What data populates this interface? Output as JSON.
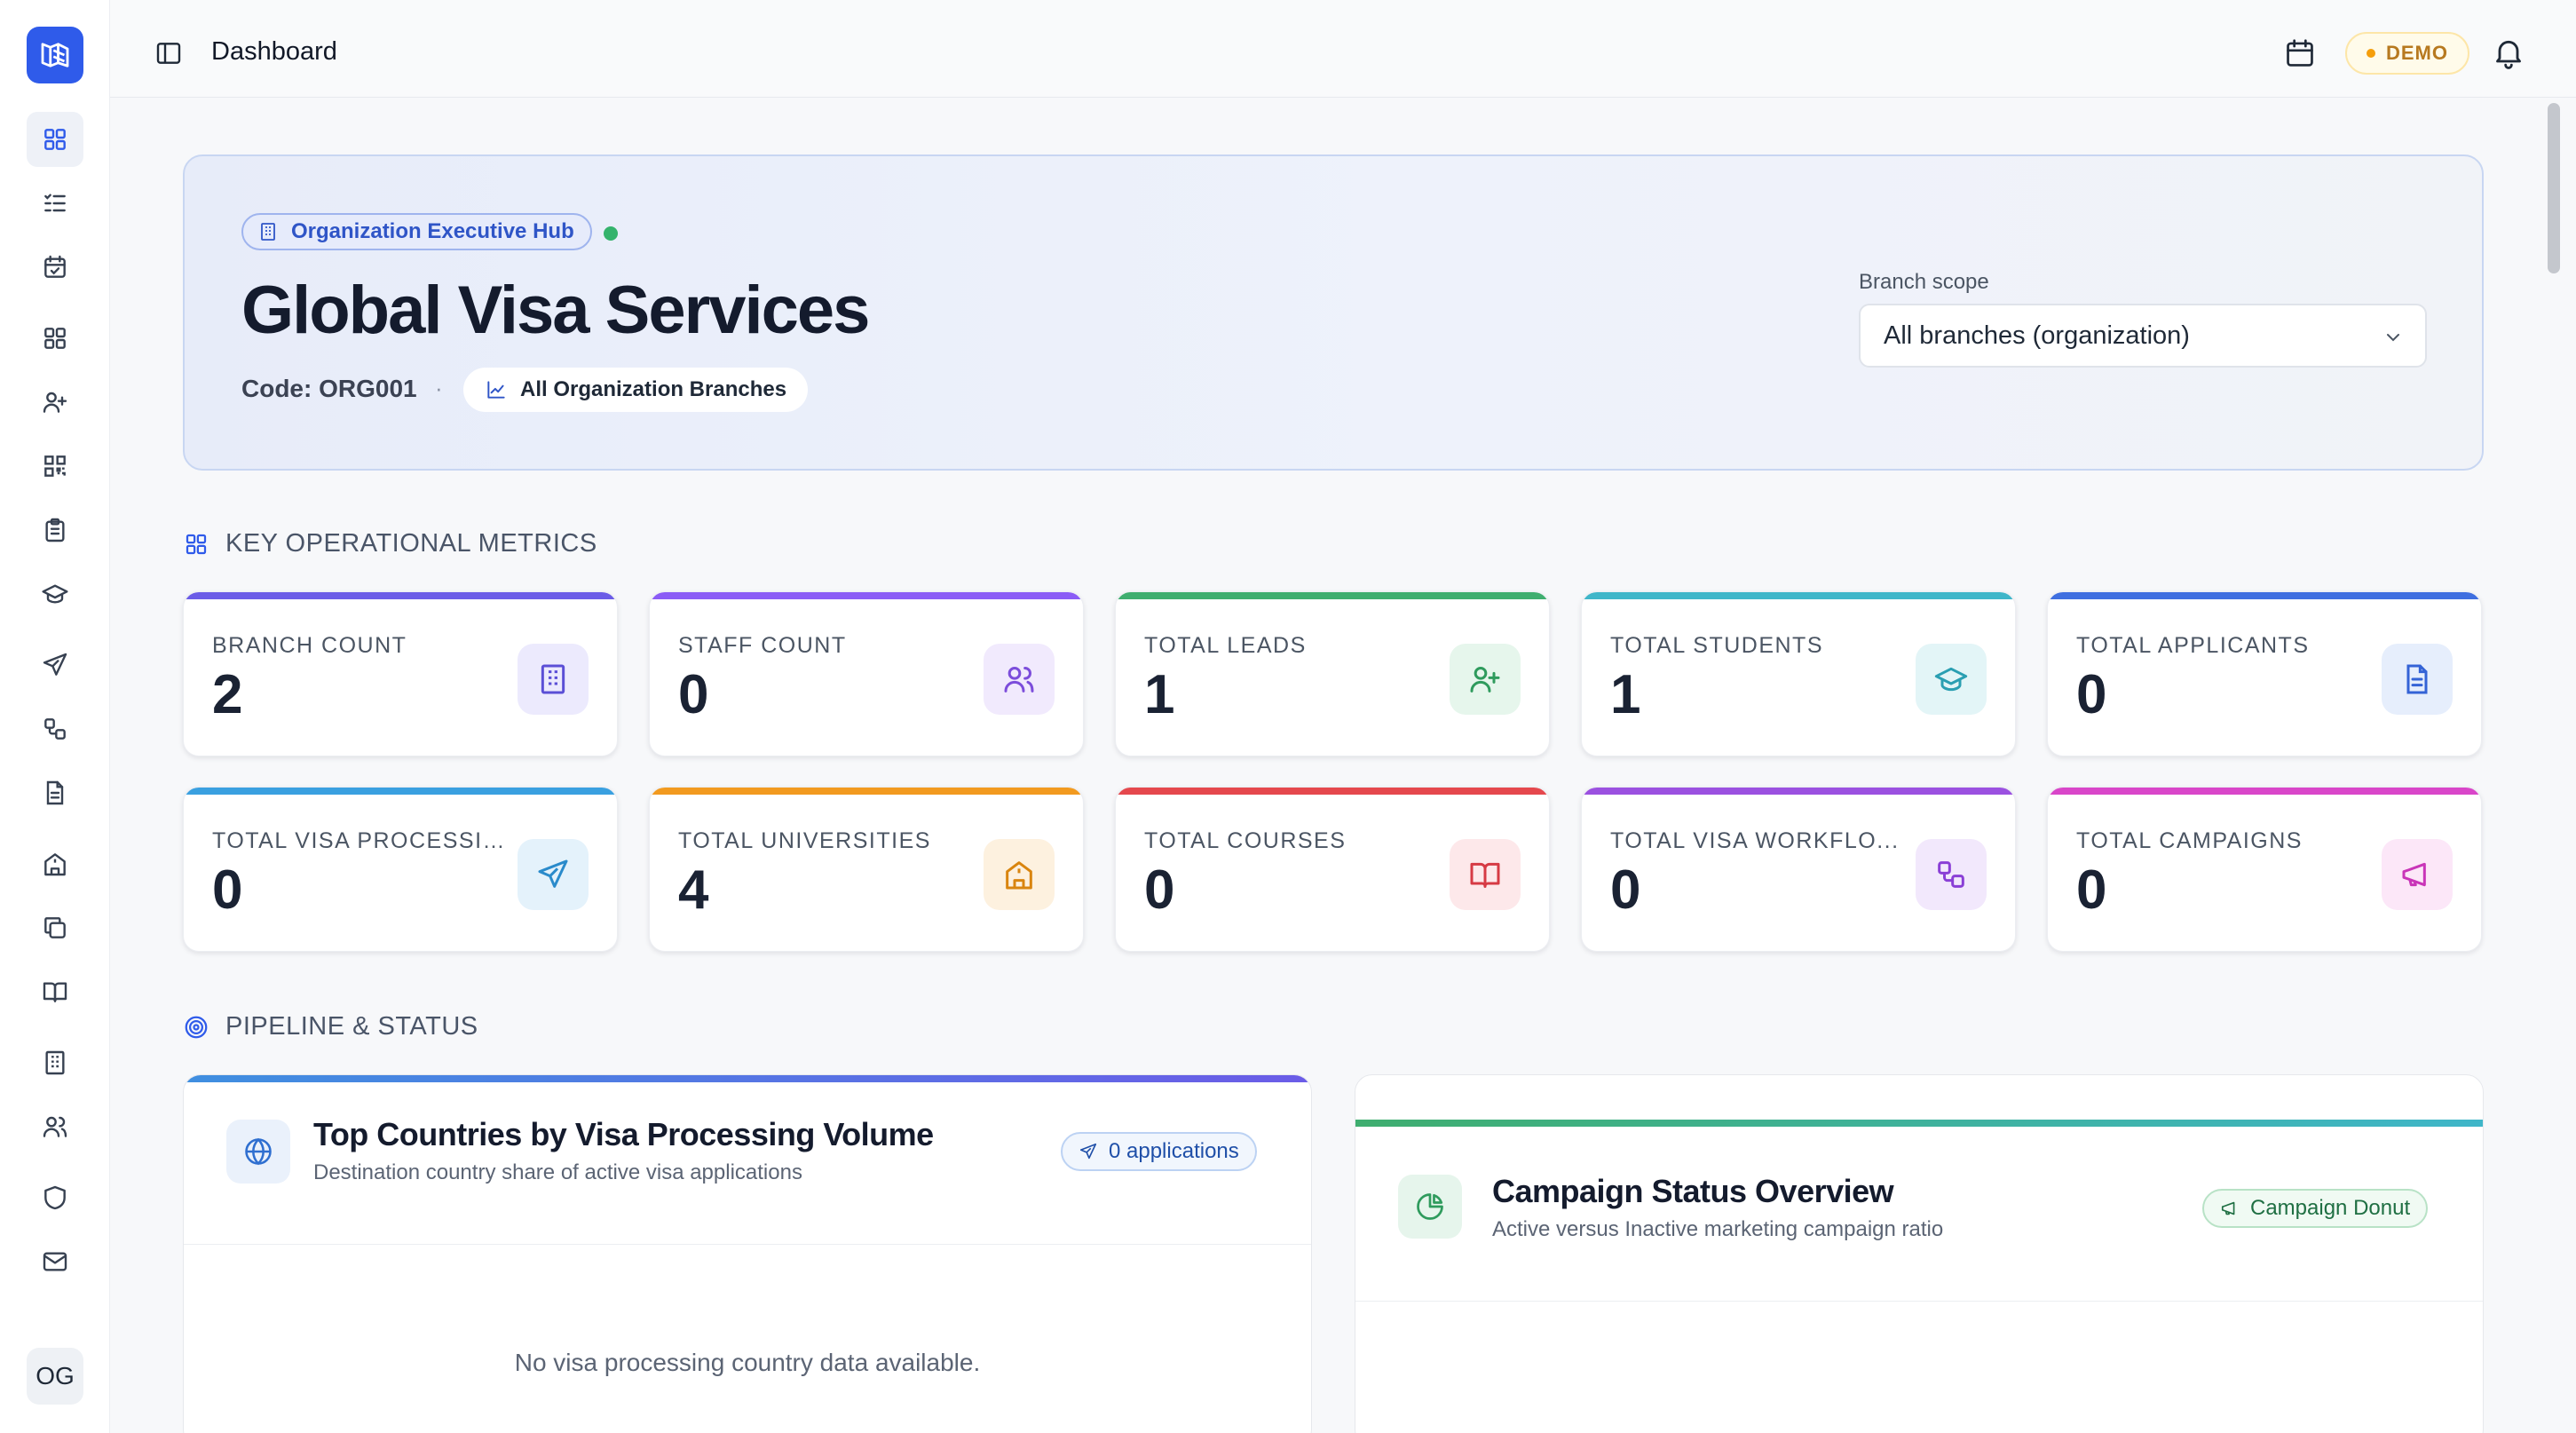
{
  "topbar": {
    "breadcrumb": "Dashboard",
    "env_badge": "DEMO"
  },
  "sidebar": {
    "avatar_initials": "OG",
    "items": [
      {
        "icon": "grid-icon",
        "active": true
      },
      {
        "icon": "list-check-icon"
      },
      {
        "icon": "calendar-check-icon"
      },
      {
        "icon": "apps-icon"
      },
      {
        "icon": "user-plus-icon"
      },
      {
        "icon": "qr-code-icon"
      },
      {
        "icon": "clipboard-icon"
      },
      {
        "icon": "graduation-cap-icon"
      },
      {
        "icon": "plane-icon"
      },
      {
        "icon": "workflow-icon"
      },
      {
        "icon": "document-icon"
      },
      {
        "icon": "university-icon"
      },
      {
        "icon": "copy-icon"
      },
      {
        "icon": "book-open-icon"
      },
      {
        "icon": "building-icon"
      },
      {
        "icon": "users-icon"
      },
      {
        "icon": "shield-icon"
      },
      {
        "icon": "mail-icon"
      }
    ]
  },
  "hero": {
    "badge": "Organization Executive Hub",
    "title": "Global Visa Services",
    "code": "Code: ORG001",
    "separator": "·",
    "branches_pill": "All Organization Branches",
    "scope_label": "Branch scope",
    "scope_value": "All branches (organization)"
  },
  "metrics": {
    "heading": "KEY OPERATIONAL METRICS",
    "cards": [
      {
        "label": "BRANCH COUNT",
        "value": "2",
        "color": "#6b5ce7",
        "icon": "building-icon"
      },
      {
        "label": "STAFF COUNT",
        "value": "0",
        "color": "#8b5cf6",
        "icon": "users-icon"
      },
      {
        "label": "TOTAL LEADS",
        "value": "1",
        "color": "#3fae6f",
        "icon": "user-plus-icon"
      },
      {
        "label": "TOTAL STUDENTS",
        "value": "1",
        "color": "#3fb6c9",
        "icon": "graduation-cap-icon"
      },
      {
        "label": "TOTAL APPLICANTS",
        "value": "0",
        "color": "#3f6fe0",
        "icon": "document-icon"
      },
      {
        "label": "TOTAL VISA PROCESSING",
        "value": "0",
        "color": "#3aa0e0",
        "icon": "plane-icon"
      },
      {
        "label": "TOTAL UNIVERSITIES",
        "value": "4",
        "color": "#f29a1f",
        "icon": "university-icon"
      },
      {
        "label": "TOTAL COURSES",
        "value": "0",
        "color": "#e5484d",
        "icon": "book-open-icon"
      },
      {
        "label": "TOTAL VISA WORKFLO...",
        "value": "0",
        "color": "#9b51e0",
        "icon": "workflow-icon"
      },
      {
        "label": "TOTAL CAMPAIGNS",
        "value": "0",
        "color": "#d946c9",
        "icon": "megaphone-icon"
      }
    ]
  },
  "pipeline": {
    "heading": "PIPELINE & STATUS",
    "countries_panel": {
      "title": "Top Countries by Visa Processing Volume",
      "subtitle": "Destination country share of active visa applications",
      "pill": "0 applications",
      "empty": "No visa processing country data available."
    },
    "campaign_panel": {
      "title": "Campaign Status Overview",
      "subtitle": "Active versus Inactive marketing campaign ratio",
      "pill": "Campaign Donut"
    }
  },
  "colors": {
    "accent": "#2f5bea",
    "demo": "#b7791f",
    "live": "#34b36c"
  }
}
